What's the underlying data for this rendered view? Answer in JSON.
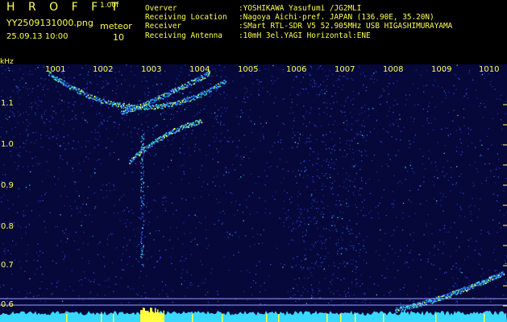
{
  "header": {
    "app_title": "H R O F F T",
    "version": "1.00f",
    "filename": "YY2509131000.png",
    "meteor_label": "meteor",
    "datetime": "25.09.13 10:00",
    "meteor_count": "10"
  },
  "info": [
    {
      "key": "Overver",
      "value": ":YOSHIKAWA Yasufumi /JG2MLI"
    },
    {
      "key": "Receiving Location",
      "value": ":Nagoya Aichi-pref. JAPAN (136.90E, 35.20N)"
    },
    {
      "key": "Receiver",
      "value": ":SMart RTL-SDR V5 52.905MHz USB HIGASHIMURAYAMA"
    },
    {
      "key": "Receiving Antenna",
      "value": ":10mH 3el.YAGI Horizontal:ENE"
    }
  ],
  "axis": {
    "unit": "kHz",
    "y_ticks": [
      "1.1",
      "1.0",
      "0.9",
      "0.8",
      "0.7",
      "0.6"
    ],
    "x_ticks": [
      "1001",
      "1002",
      "1003",
      "1004",
      "1005",
      "1006",
      "1007",
      "1008",
      "1009",
      "1010"
    ]
  },
  "colors": {
    "background": "#000000",
    "label": "#ffff55",
    "spectrogram_base": "#06083a",
    "signal_low": "#2a4fd6",
    "signal_mid": "#30d0e0",
    "signal_high": "#ffff40",
    "baseline_trace": "#38d8ff",
    "guide_line": "#9aa0ff"
  }
}
